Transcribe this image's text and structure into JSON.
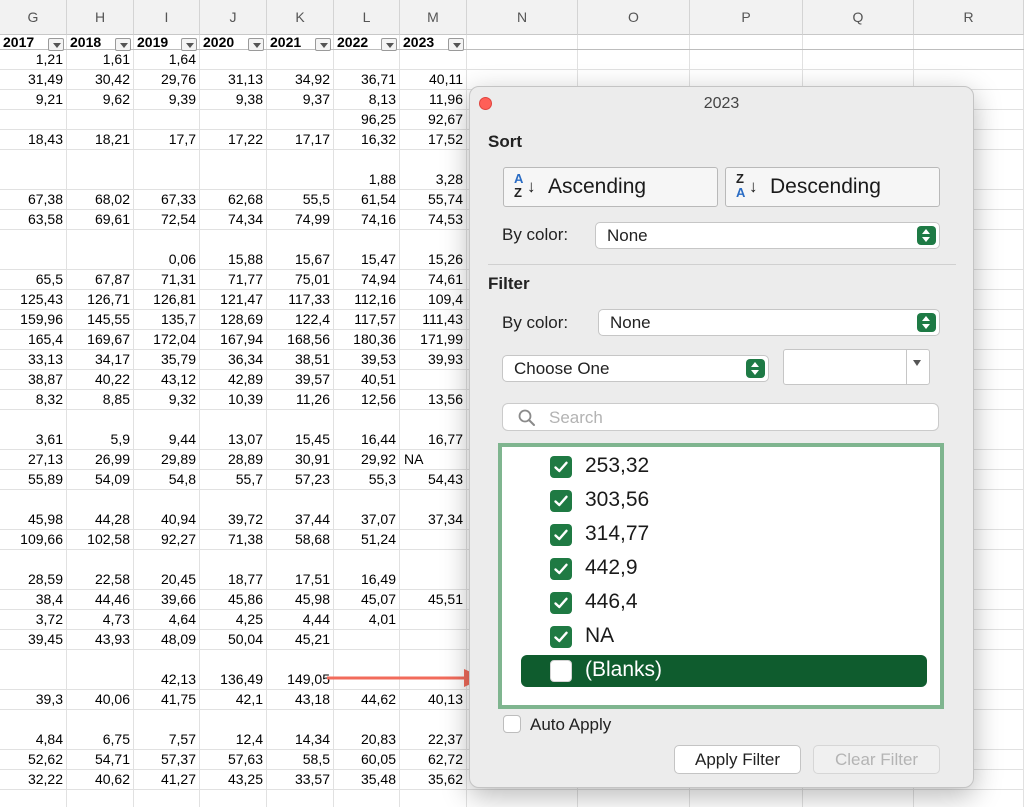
{
  "sheet": {
    "columns": [
      "G",
      "H",
      "I",
      "J",
      "K",
      "L",
      "M",
      "N",
      "O",
      "P",
      "Q",
      "R"
    ],
    "header_row": [
      "2017",
      "2018",
      "2019",
      "2020",
      "2021",
      "2022",
      "2023"
    ],
    "rows": [
      [
        "1,21",
        "1,61",
        "1,64",
        "",
        "",
        "",
        ""
      ],
      [
        "31,49",
        "30,42",
        "29,76",
        "31,13",
        "34,92",
        "36,71",
        "40,11"
      ],
      [
        "9,21",
        "9,62",
        "9,39",
        "9,38",
        "9,37",
        "8,13",
        "11,96"
      ],
      [
        "",
        "",
        "",
        "",
        "",
        "96,25",
        "92,67"
      ],
      [
        "18,43",
        "18,21",
        "17,7",
        "17,22",
        "17,17",
        "16,32",
        "17,52"
      ],
      [
        "",
        "",
        "",
        "",
        "",
        "1,88",
        "3,28"
      ],
      [
        "67,38",
        "68,02",
        "67,33",
        "62,68",
        "55,5",
        "61,54",
        "55,74"
      ],
      [
        "63,58",
        "69,61",
        "72,54",
        "74,34",
        "74,99",
        "74,16",
        "74,53"
      ],
      [
        "",
        "",
        "0,06",
        "15,88",
        "15,67",
        "15,47",
        "15,26"
      ],
      [
        "65,5",
        "67,87",
        "71,31",
        "71,77",
        "75,01",
        "74,94",
        "74,61"
      ],
      [
        "125,43",
        "126,71",
        "126,81",
        "121,47",
        "117,33",
        "112,16",
        "109,4"
      ],
      [
        "159,96",
        "145,55",
        "135,7",
        "128,69",
        "122,4",
        "117,57",
        "111,43"
      ],
      [
        "165,4",
        "169,67",
        "172,04",
        "167,94",
        "168,56",
        "180,36",
        "171,99"
      ],
      [
        "33,13",
        "34,17",
        "35,79",
        "36,34",
        "38,51",
        "39,53",
        "39,93"
      ],
      [
        "38,87",
        "40,22",
        "43,12",
        "42,89",
        "39,57",
        "40,51",
        ""
      ],
      [
        "8,32",
        "8,85",
        "9,32",
        "10,39",
        "11,26",
        "12,56",
        "13,56"
      ],
      [
        "3,61",
        "5,9",
        "9,44",
        "13,07",
        "15,45",
        "16,44",
        "16,77"
      ],
      [
        "27,13",
        "26,99",
        "29,89",
        "28,89",
        "30,91",
        "29,92",
        "NA"
      ],
      [
        "55,89",
        "54,09",
        "54,8",
        "55,7",
        "57,23",
        "55,3",
        "54,43"
      ],
      [
        "45,98",
        "44,28",
        "40,94",
        "39,72",
        "37,44",
        "37,07",
        "37,34"
      ],
      [
        "109,66",
        "102,58",
        "92,27",
        "71,38",
        "58,68",
        "51,24",
        ""
      ],
      [
        "28,59",
        "22,58",
        "20,45",
        "18,77",
        "17,51",
        "16,49",
        ""
      ],
      [
        "38,4",
        "44,46",
        "39,66",
        "45,86",
        "45,98",
        "45,07",
        "45,51"
      ],
      [
        "3,72",
        "4,73",
        "4,64",
        "4,25",
        "4,44",
        "4,01",
        ""
      ],
      [
        "39,45",
        "43,93",
        "48,09",
        "50,04",
        "45,21",
        "",
        ""
      ],
      [
        "",
        "",
        "42,13",
        "136,49",
        "149,05",
        "",
        ""
      ],
      [
        "39,3",
        "40,06",
        "41,75",
        "42,1",
        "43,18",
        "44,62",
        "40,13"
      ],
      [
        "4,84",
        "6,75",
        "7,57",
        "12,4",
        "14,34",
        "20,83",
        "22,37"
      ],
      [
        "52,62",
        "54,71",
        "57,37",
        "57,63",
        "58,5",
        "60,05",
        "62,72"
      ],
      [
        "32,22",
        "40,62",
        "41,27",
        "43,25",
        "33,57",
        "35,48",
        "35,62"
      ]
    ]
  },
  "dialog": {
    "title": "2023",
    "sort_label": "Sort",
    "ascending_label": "Ascending",
    "descending_label": "Descending",
    "sort_icon_asc": [
      "A",
      "Z"
    ],
    "sort_icon_desc": [
      "Z",
      "A"
    ],
    "sort_by_color_label": "By color:",
    "sort_by_color_value": "None",
    "filter_label": "Filter",
    "filter_by_color_label": "By color:",
    "filter_by_color_value": "None",
    "condition_value": "Choose One",
    "criteria_value": "",
    "search_placeholder": "Search",
    "items": [
      {
        "label": "253,32",
        "checked": true
      },
      {
        "label": "303,56",
        "checked": true
      },
      {
        "label": "314,77",
        "checked": true
      },
      {
        "label": "442,9",
        "checked": true
      },
      {
        "label": "446,4",
        "checked": true
      },
      {
        "label": "NA",
        "checked": true
      },
      {
        "label": "(Blanks)",
        "checked": false
      }
    ],
    "auto_apply_label": "Auto Apply",
    "auto_apply_checked": false,
    "apply_button": "Apply Filter",
    "clear_button": "Clear Filter"
  },
  "colors": {
    "accent_green": "#1f7a43",
    "selected_row": "#0f5c2e",
    "list_border": "#7fb58f",
    "arrow": "#f26b5b"
  },
  "icons": {
    "close": "close-icon",
    "search": "search-icon",
    "checkbox": "checkbox-checked-icon",
    "dropdown": "dropdown-arrow-icon",
    "sort_asc": "sort-ascending-icon",
    "sort_desc": "sort-descending-icon"
  }
}
